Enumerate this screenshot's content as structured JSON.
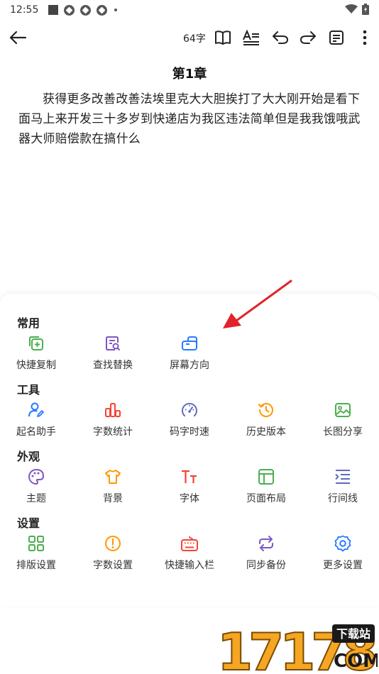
{
  "status_bar": {
    "time": "12:55"
  },
  "toolbar": {
    "word_count": "64字",
    "icons": [
      "back-arrow-icon",
      "book-icon",
      "text-format-icon",
      "undo-icon",
      "redo-icon",
      "note-icon",
      "more-vertical-icon"
    ]
  },
  "chapter": {
    "title": "第1章",
    "body": "获得更多改善改善法埃里克大大胆挨打了大大刚开始是看下面马上来开发三十多岁到快递店为我区违法简单但是我我饿哦武器大师赔偿款在搞什么"
  },
  "panel": {
    "sections": [
      {
        "label": "常用",
        "items": [
          {
            "label": "快捷复制",
            "icon": "quick-copy-icon",
            "color": "#4caf50"
          },
          {
            "label": "查找替换",
            "icon": "find-replace-icon",
            "color": "#7e57c2"
          },
          {
            "label": "屏幕方向",
            "icon": "screen-orientation-icon",
            "color": "#2979ff"
          }
        ]
      },
      {
        "label": "工具",
        "items": [
          {
            "label": "起名助手",
            "icon": "name-helper-icon",
            "color": "#2979ff"
          },
          {
            "label": "字数统计",
            "icon": "word-stats-icon",
            "color": "#f44336"
          },
          {
            "label": "码字时速",
            "icon": "typing-speed-icon",
            "color": "#5c6bc0"
          },
          {
            "label": "历史版本",
            "icon": "history-icon",
            "color": "#ff9800"
          },
          {
            "label": "长图分享",
            "icon": "image-share-icon",
            "color": "#4caf50"
          }
        ]
      },
      {
        "label": "外观",
        "items": [
          {
            "label": "主题",
            "icon": "palette-icon",
            "color": "#7e57c2"
          },
          {
            "label": "背景",
            "icon": "shirt-icon",
            "color": "#ff9800"
          },
          {
            "label": "字体",
            "icon": "font-icon",
            "color": "#f44336"
          },
          {
            "label": "页面布局",
            "icon": "layout-icon",
            "color": "#4caf50"
          },
          {
            "label": "行间线",
            "icon": "line-spacing-icon",
            "color": "#5c6bc0"
          }
        ]
      },
      {
        "label": "设置",
        "items": [
          {
            "label": "排版设置",
            "icon": "grid-icon",
            "color": "#4caf50"
          },
          {
            "label": "字数设置",
            "icon": "alert-circle-icon",
            "color": "#ff9800"
          },
          {
            "label": "快捷输入栏",
            "icon": "keyboard-icon",
            "color": "#f44336"
          },
          {
            "label": "同步备份",
            "icon": "sync-icon",
            "color": "#7e57c2"
          },
          {
            "label": "更多设置",
            "icon": "gear-icon",
            "color": "#2979ff"
          }
        ]
      }
    ]
  },
  "watermark": {
    "digits": "17178",
    "tag": "下载站",
    "domain": "COM"
  }
}
